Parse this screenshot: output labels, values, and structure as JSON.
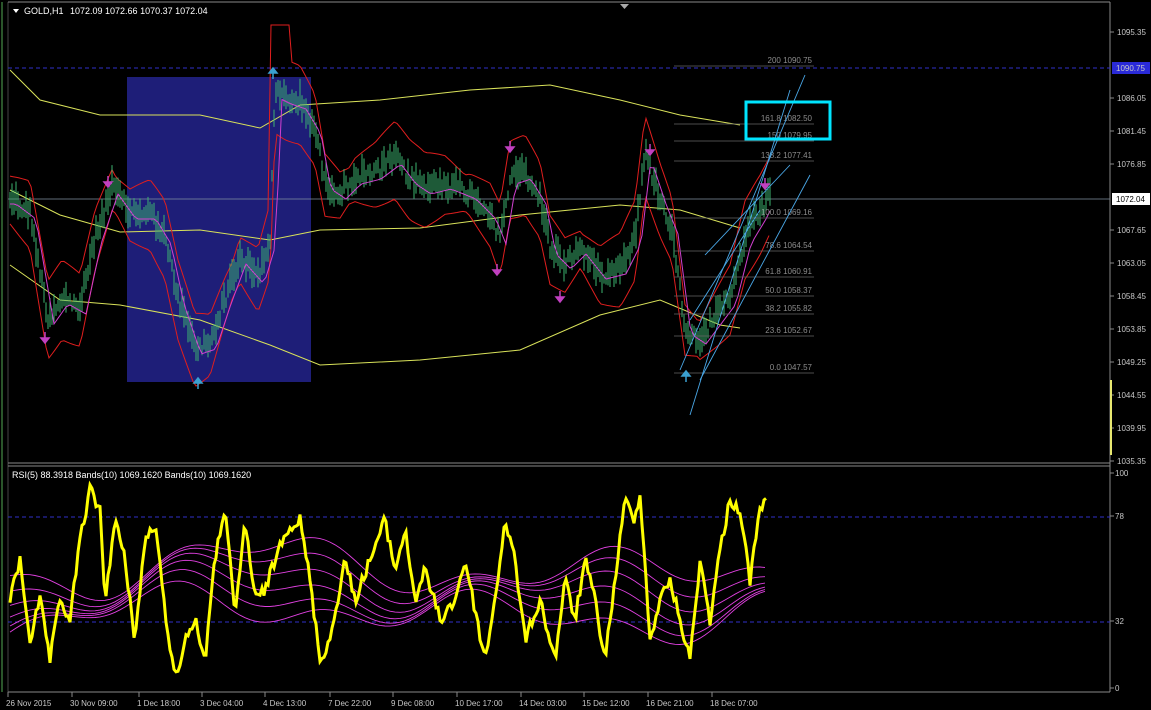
{
  "header": {
    "symbol": "GOLD,H1",
    "ohlc": "1072.09 1072.66 1070.37 1072.04"
  },
  "price_axis": {
    "ticks": [
      "1095.35",
      "1090.75",
      "1086.05",
      "1081.45",
      "1076.85",
      "1072.04",
      "1067.65",
      "1063.05",
      "1058.45",
      "1053.85",
      "1049.25",
      "1044.55",
      "1039.95",
      "1035.35"
    ],
    "current_price": "1072.04",
    "highlight_label": "1090.75"
  },
  "time_axis": {
    "labels": [
      "26 Nov 2015",
      "30 Nov 09:00",
      "1 Dec 18:00",
      "3 Dec 04:00",
      "4 Dec 13:00",
      "7 Dec 22:00",
      "9 Dec 08:00",
      "10 Dec 17:00",
      "14 Dec 03:00",
      "15 Dec 12:00",
      "16 Dec 21:00",
      "18 Dec 07:00"
    ]
  },
  "fibonacci": {
    "levels": [
      "200 1090.75",
      "161.8 1082.50",
      "150 1079.95",
      "138.2 1077.41",
      "100.0 1069.16",
      "78.6 1064.54",
      "61.8 1060.91",
      "50.0 1058.37",
      "38.2 1055.82",
      "23.6 1052.67",
      "0.0 1047.57"
    ]
  },
  "rsi_panel": {
    "label": "RSI(5) 88.3918  Bands(10) 1069.1620  Bands(10) 1069.1620",
    "ticks": [
      "100",
      "78",
      "32",
      "0"
    ]
  },
  "colors": {
    "background": "#000000",
    "candles": "#3cb371",
    "bollinger": "#d9e25a",
    "envelope": "#e01e1e",
    "ma": "#d040d0",
    "rsi": "#ffff00",
    "rsi_bands": "#e040e0",
    "highlight_box": "#1e1e78",
    "cyan_box": "#00e5ff",
    "level_line": "#3030c8",
    "arrow_up": "#3aa0d0",
    "arrow_down": "#c040c0"
  },
  "icons": {
    "menu": "triangle-down-icon",
    "scroll": "triangle-down-icon"
  }
}
